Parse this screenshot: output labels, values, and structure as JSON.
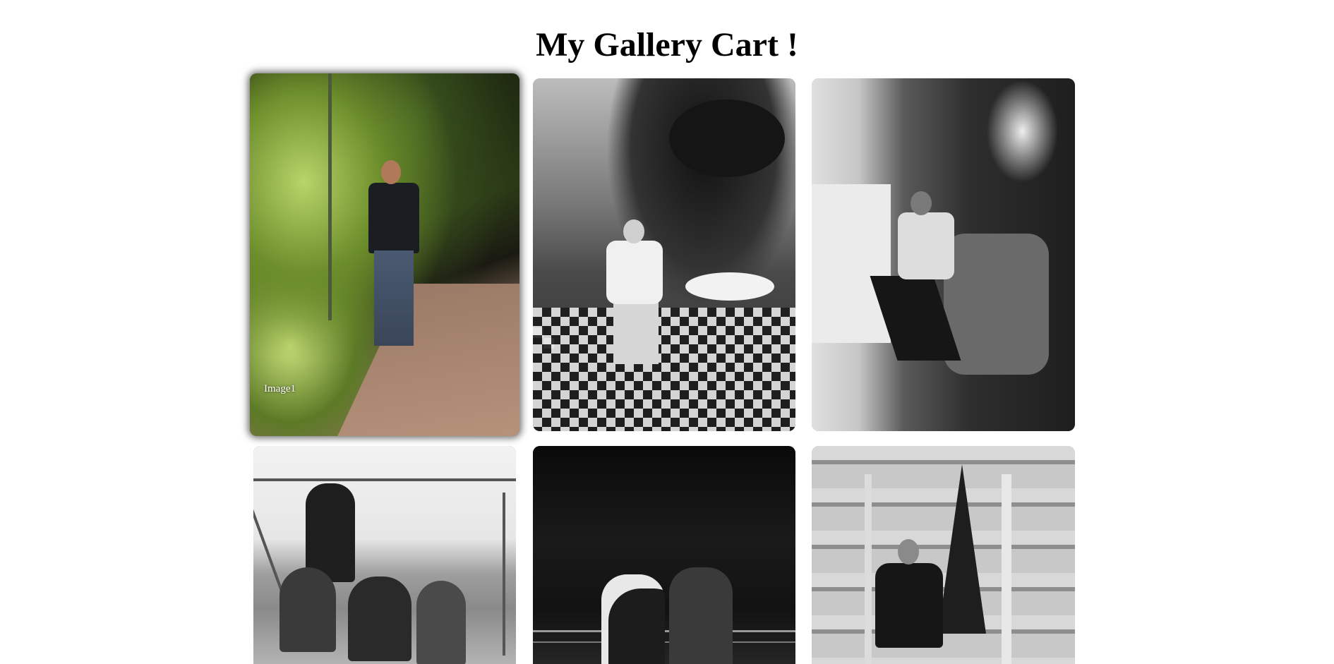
{
  "page": {
    "title": "My Gallery Cart !"
  },
  "gallery": {
    "items": [
      {
        "caption": "Image1"
      },
      {
        "caption": ""
      },
      {
        "caption": ""
      },
      {
        "caption": ""
      },
      {
        "caption": ""
      },
      {
        "caption": ""
      }
    ]
  }
}
